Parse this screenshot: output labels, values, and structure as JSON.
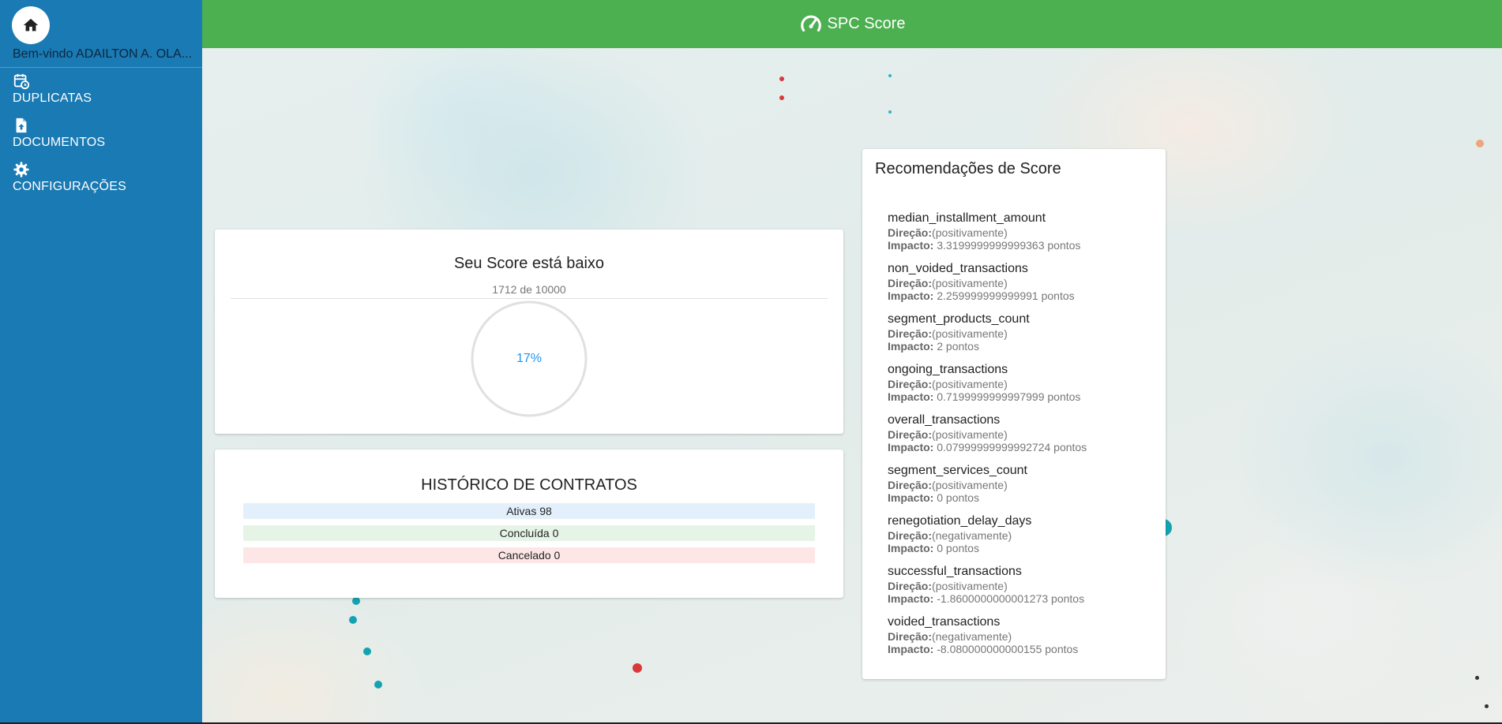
{
  "sidebar": {
    "welcome": "Bem-vindo ADAILTON A. OLA...",
    "items": [
      {
        "label": "DUPLICATAS",
        "icon": "calendar-clock-icon"
      },
      {
        "label": "DOCUMENTOS",
        "icon": "file-upload-icon"
      },
      {
        "label": "CONFIGURAÇÕES",
        "icon": "gear-icon"
      }
    ]
  },
  "header": {
    "title": "SPC Score",
    "icon": "speedometer-icon"
  },
  "score": {
    "title": "Seu Score está baixo",
    "subtitle": "1712 de 10000",
    "percent_label": "17%",
    "percent": 17
  },
  "history": {
    "title": "HISTÓRICO DE CONTRATOS",
    "rows": [
      "Ativas 98",
      "Concluída 0",
      "Cancelado 0"
    ]
  },
  "recommendations": {
    "title": "Recomendações de Score",
    "direction_label": "Direção:",
    "impact_label": "Impacto:",
    "items": [
      {
        "name": "median_installment_amount",
        "direction": "(positivamente)",
        "impact": "3.3199999999999363 pontos"
      },
      {
        "name": "non_voided_transactions",
        "direction": "(positivamente)",
        "impact": "2.259999999999991 pontos"
      },
      {
        "name": "segment_products_count",
        "direction": "(positivamente)",
        "impact": "2 pontos"
      },
      {
        "name": "ongoing_transactions",
        "direction": "(positivamente)",
        "impact": "0.7199999999997999 pontos"
      },
      {
        "name": "overall_transactions",
        "direction": "(positivamente)",
        "impact": "0.07999999999992724 pontos"
      },
      {
        "name": "segment_services_count",
        "direction": "(positivamente)",
        "impact": "0 pontos"
      },
      {
        "name": "renegotiation_delay_days",
        "direction": "(negativamente)",
        "impact": "0 pontos"
      },
      {
        "name": "successful_transactions",
        "direction": "(positivamente)",
        "impact": "-1.8600000000001273 pontos"
      },
      {
        "name": "voided_transactions",
        "direction": "(negativamente)",
        "impact": "-8.080000000000155 pontos"
      }
    ]
  },
  "colors": {
    "sidebar": "#1a7ab3",
    "header": "#4caf50",
    "accent": "#2196f3"
  }
}
